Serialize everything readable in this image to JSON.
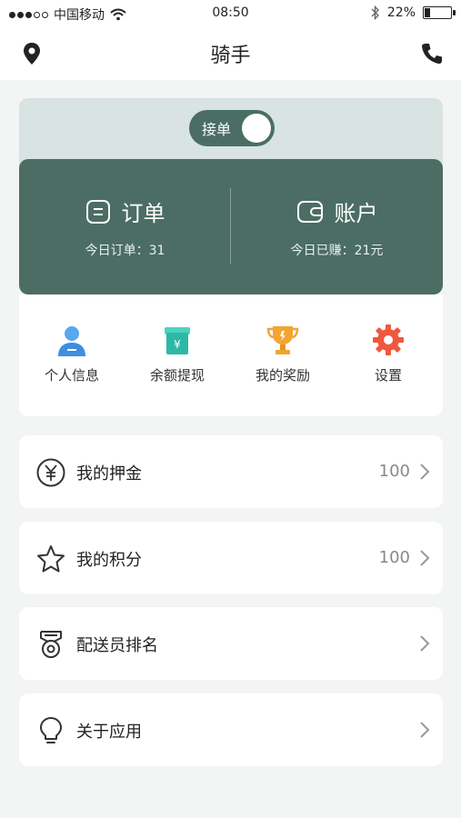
{
  "status_bar": {
    "carrier": "中国移动",
    "time": "08:50",
    "battery_percent": "22%",
    "battery_level": 0.22,
    "signal_bars_filled": 3,
    "signal_bars_total": 5
  },
  "nav": {
    "title": "骑手",
    "left_icon": "location-pin-icon",
    "right_icon": "phone-icon"
  },
  "toggle": {
    "label": "接单",
    "on": true
  },
  "summary": {
    "orders": {
      "title": "订单",
      "subtitle": "今日订单：31",
      "icon": "order-list-icon"
    },
    "account": {
      "title": "账户",
      "subtitle": "今日已赚：21元",
      "icon": "wallet-icon"
    }
  },
  "quick_actions": [
    {
      "label": "个人信息",
      "icon": "person-info-icon",
      "color": "#3f8de0"
    },
    {
      "label": "余额提现",
      "icon": "balance-withdraw-icon",
      "color": "#2db8a5"
    },
    {
      "label": "我的奖励",
      "icon": "trophy-icon",
      "color": "#f2a531"
    },
    {
      "label": "设置",
      "icon": "settings-gear-icon",
      "color": "#f0583f"
    }
  ],
  "menu": [
    {
      "label": "我的押金",
      "value": "100",
      "icon": "yuan-circle-icon"
    },
    {
      "label": "我的积分",
      "value": "100",
      "icon": "star-icon"
    },
    {
      "label": "配送员排名",
      "value": "",
      "icon": "medal-icon"
    },
    {
      "label": "关于应用",
      "value": "",
      "icon": "lightbulb-icon"
    }
  ],
  "colors": {
    "accent": "#4b6d64",
    "hero_bg": "#d8e3e2",
    "page_bg": "#f3f4f4"
  }
}
